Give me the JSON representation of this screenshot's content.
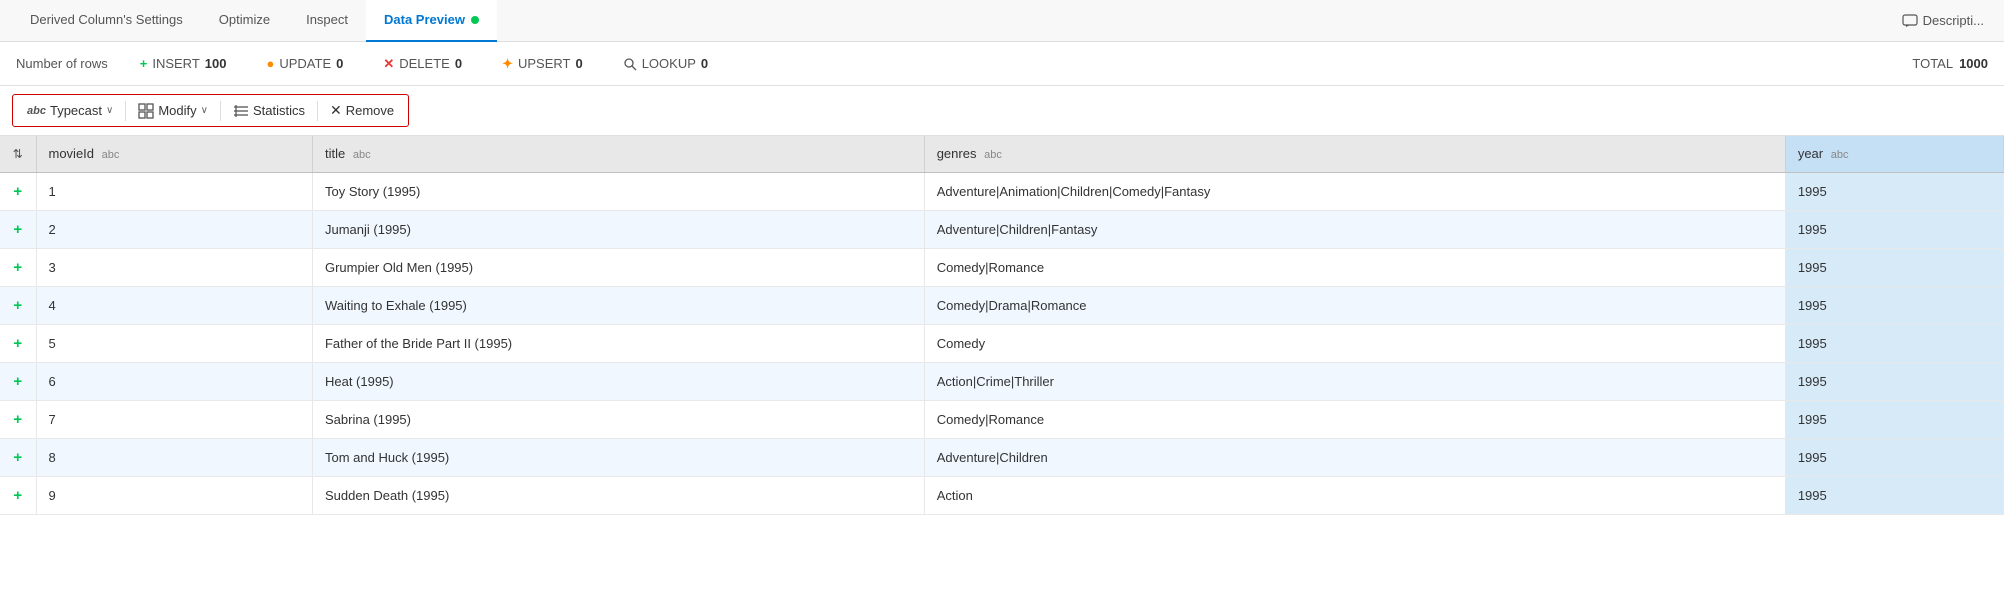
{
  "tabs": [
    {
      "id": "derived-settings",
      "label": "Derived Column's Settings",
      "active": false
    },
    {
      "id": "optimize",
      "label": "Optimize",
      "active": false
    },
    {
      "id": "inspect",
      "label": "Inspect",
      "active": false
    },
    {
      "id": "data-preview",
      "label": "Data Preview",
      "active": true
    }
  ],
  "tab_dot_color": "#00c853",
  "description_btn_label": "Descripti...",
  "stats": {
    "label": "Number of rows",
    "insert": {
      "icon": "+",
      "label": "INSERT",
      "value": "100"
    },
    "update": {
      "icon": "●",
      "label": "UPDATE",
      "value": "0"
    },
    "delete": {
      "icon": "×",
      "label": "DELETE",
      "value": "0"
    },
    "upsert": {
      "icon": "●",
      "label": "UPSERT",
      "value": "0"
    },
    "lookup": {
      "icon": "🔍",
      "label": "LOOKUP",
      "value": "0"
    },
    "total_label": "TOTAL",
    "total_value": "1000"
  },
  "toolbar": {
    "typecast": {
      "icon": "abc",
      "label": "Typecast",
      "has_chevron": true
    },
    "modify": {
      "icon": "⊞",
      "label": "Modify",
      "has_chevron": true
    },
    "statistics": {
      "icon": "≡",
      "label": "Statistics",
      "has_chevron": false
    },
    "remove": {
      "icon": "×",
      "label": "Remove",
      "has_chevron": false
    }
  },
  "table": {
    "columns": [
      {
        "id": "sort",
        "label": "⇅",
        "type": ""
      },
      {
        "id": "movieId",
        "label": "movieId",
        "type": "abc"
      },
      {
        "id": "title",
        "label": "title",
        "type": "abc"
      },
      {
        "id": "genres",
        "label": "genres",
        "type": "abc"
      },
      {
        "id": "year",
        "label": "year",
        "type": "abc"
      }
    ],
    "rows": [
      {
        "add": "+",
        "movieId": "1",
        "title": "Toy Story (1995)",
        "genres": "Adventure|Animation|Children|Comedy|Fantasy",
        "year": "1995"
      },
      {
        "add": "+",
        "movieId": "2",
        "title": "Jumanji (1995)",
        "genres": "Adventure|Children|Fantasy",
        "year": "1995"
      },
      {
        "add": "+",
        "movieId": "3",
        "title": "Grumpier Old Men (1995)",
        "genres": "Comedy|Romance",
        "year": "1995"
      },
      {
        "add": "+",
        "movieId": "4",
        "title": "Waiting to Exhale (1995)",
        "genres": "Comedy|Drama|Romance",
        "year": "1995"
      },
      {
        "add": "+",
        "movieId": "5",
        "title": "Father of the Bride Part II (1995)",
        "genres": "Comedy",
        "year": "1995"
      },
      {
        "add": "+",
        "movieId": "6",
        "title": "Heat (1995)",
        "genres": "Action|Crime|Thriller",
        "year": "1995"
      },
      {
        "add": "+",
        "movieId": "7",
        "title": "Sabrina (1995)",
        "genres": "Comedy|Romance",
        "year": "1995"
      },
      {
        "add": "+",
        "movieId": "8",
        "title": "Tom and Huck (1995)",
        "genres": "Adventure|Children",
        "year": "1995"
      },
      {
        "add": "+",
        "movieId": "9",
        "title": "Sudden Death (1995)",
        "genres": "Action",
        "year": "1995"
      }
    ]
  }
}
